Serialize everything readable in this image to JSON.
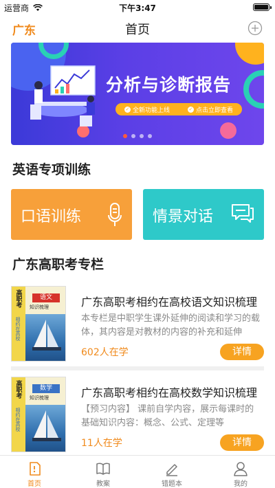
{
  "status": {
    "carrier": "运营商",
    "time": "下午3:47",
    "battery_level": 1.0
  },
  "nav": {
    "city": "广东",
    "title": "首页"
  },
  "banner": {
    "title": "分析与诊断报告",
    "tags": [
      "全新功能上线",
      "点击立即查看"
    ],
    "slide_count": 4,
    "active_slide": 1,
    "colors": {
      "background": "#5b3fe6",
      "accent": "#ffb21e",
      "teal": "#2ad1b5"
    }
  },
  "english": {
    "section_title": "英语专项训练",
    "cards": [
      {
        "label": "口语训练",
        "icon": "microphone-icon",
        "color": "#f7a03a"
      },
      {
        "label": "情景对话",
        "icon": "chat-bubbles-icon",
        "color": "#2ec9c9"
      }
    ]
  },
  "column": {
    "section_title": "广东高职考专栏",
    "courses": [
      {
        "cover": {
          "strip": "高职考",
          "side": "相约在高校",
          "subject": "语文",
          "subtitle": "知识梳理"
        },
        "title": "广东高职考相约在高校语文知识梳理",
        "desc": "本专栏是中职学生课外延伸的阅读和学习的载体，其内容是对教材的内容的补充和延伸",
        "count": "602人在学",
        "button": "详情"
      },
      {
        "cover": {
          "strip": "高职考",
          "side": "相约在高校",
          "subject": "数学",
          "subtitle": "知识梳理"
        },
        "title": "广东高职考相约在高校数学知识梳理",
        "desc": "【预习内容】 课前自学内容，展示每课时的基础知识内容：概念、公式、定理等",
        "count": "11人在学",
        "button": "详情"
      }
    ]
  },
  "tabs": [
    {
      "label": "首页",
      "icon": "home-icon",
      "active": true
    },
    {
      "label": "教案",
      "icon": "book-icon",
      "active": false
    },
    {
      "label": "错题本",
      "icon": "pencil-icon",
      "active": false
    },
    {
      "label": "我的",
      "icon": "user-icon",
      "active": false
    }
  ],
  "colors": {
    "accent": "#f08a1c",
    "button": "#f7a321",
    "inactive": "#777777"
  }
}
